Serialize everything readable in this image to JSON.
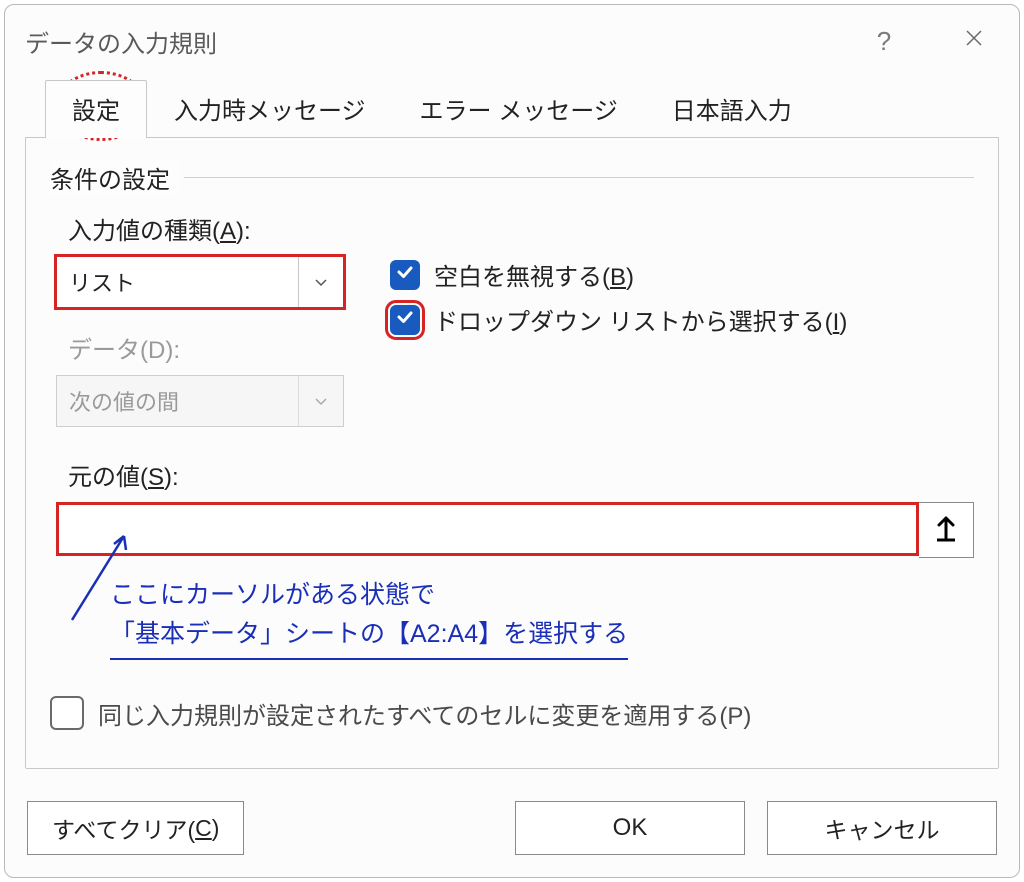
{
  "dialog": {
    "title": "データの入力規則",
    "help_tooltip": "?",
    "tabs": [
      {
        "label": "設定",
        "active": true
      },
      {
        "label": "入力時メッセージ",
        "active": false
      },
      {
        "label": "エラー メッセージ",
        "active": false
      },
      {
        "label": "日本語入力",
        "active": false
      }
    ],
    "group_title": "条件の設定",
    "allow": {
      "label_prefix": "入力値の種類(",
      "label_key": "A",
      "label_suffix": "):",
      "value": "リスト"
    },
    "ignore_blank": {
      "checked": true,
      "label_prefix": "空白を無視する(",
      "label_key": "B",
      "label_suffix": ")"
    },
    "in_cell_dropdown": {
      "checked": true,
      "label_prefix": "ドロップダウン リストから選択する(",
      "label_key": "I",
      "label_suffix": ")"
    },
    "data": {
      "label": "データ(D):",
      "value": "次の値の間",
      "disabled": true
    },
    "source": {
      "label_prefix": "元の値(",
      "label_key": "S",
      "label_suffix": "):",
      "value": ""
    },
    "annotation": {
      "line1": "ここにカーソルがある状態で",
      "line2": "「基本データ」シートの【A2:A4】を選択する"
    },
    "apply_all": {
      "checked": false,
      "label": "同じ入力規則が設定されたすべてのセルに変更を適用する(P)"
    },
    "buttons": {
      "clear_prefix": "すべてクリア(",
      "clear_key": "C",
      "clear_suffix": ")",
      "ok": "OK",
      "cancel": "キャンセル"
    }
  },
  "colors": {
    "highlight": "#d62424",
    "accent": "#185abd",
    "annotation": "#1a2fb8"
  }
}
